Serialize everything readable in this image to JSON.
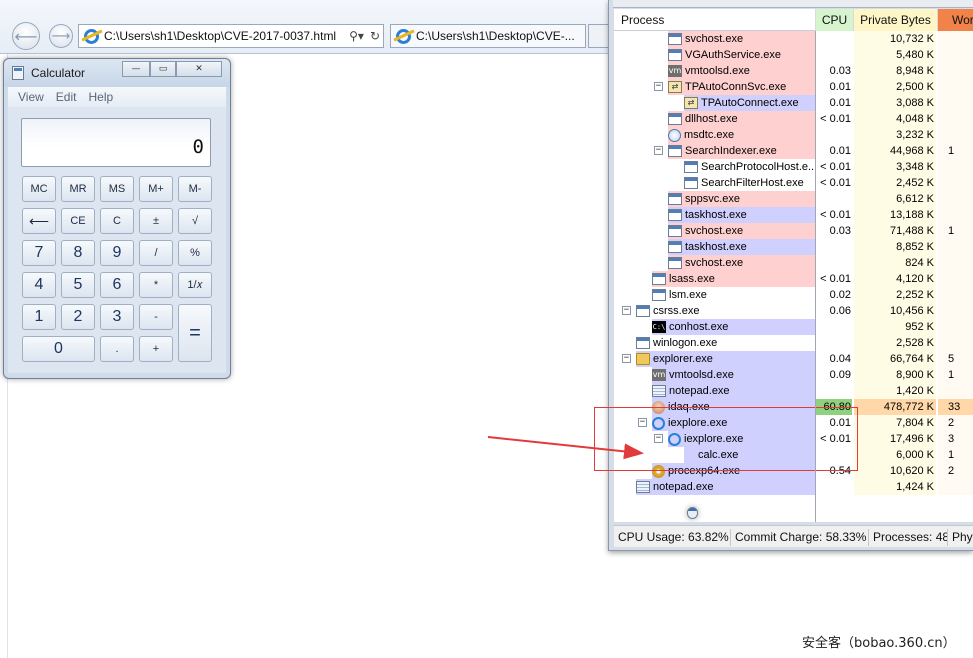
{
  "browser": {
    "address": "C:\\Users\\sh1\\Desktop\\CVE-2017-0037.html",
    "tab_title": "C:\\Users\\sh1\\Desktop\\CVE-...",
    "search_icon": "search-icon",
    "refresh_icon": "refresh-icon"
  },
  "calculator": {
    "title": "Calculator",
    "menu": [
      "View",
      "Edit",
      "Help"
    ],
    "display": "0",
    "keys": {
      "mc": "MC",
      "mr": "MR",
      "ms": "MS",
      "mplus": "M+",
      "mminus": "M-",
      "back": "⟵",
      "ce": "CE",
      "c": "C",
      "pm": "±",
      "sqrt": "√",
      "k7": "7",
      "k8": "8",
      "k9": "9",
      "div": "/",
      "pct": "%",
      "k4": "4",
      "k5": "5",
      "k6": "6",
      "mul": "*",
      "recip": "1/𝑥",
      "k1": "1",
      "k2": "2",
      "k3": "3",
      "sub": "-",
      "eq": "=",
      "k0": "0",
      "dot": ".",
      "add": "+"
    }
  },
  "procexp": {
    "headers": {
      "process": "Process",
      "cpu": "CPU",
      "private_bytes": "Private Bytes",
      "working_set": "Wor"
    },
    "colors": {
      "service": "#ffd0d0",
      "own": "#d0d0ff",
      "cpu_header": "#d6f5cf",
      "pb_header": "#fff6c8",
      "ws_header": "#f0824a",
      "highlight_cpu": "#8fd17e",
      "highlight_pb": "#ffd7a8"
    },
    "rows": [
      {
        "name": "svchost.exe",
        "cpu": "",
        "pb": "10,732 K",
        "ws": ""
      },
      {
        "name": "VGAuthService.exe",
        "cpu": "",
        "pb": "5,480 K",
        "ws": ""
      },
      {
        "name": "vmtoolsd.exe",
        "cpu": "0.03",
        "pb": "8,948 K",
        "ws": ""
      },
      {
        "name": "TPAutoConnSvc.exe",
        "cpu": "0.01",
        "pb": "2,500 K",
        "ws": ""
      },
      {
        "name": "TPAutoConnect.exe",
        "cpu": "0.01",
        "pb": "3,088 K",
        "ws": ""
      },
      {
        "name": "dllhost.exe",
        "cpu": "< 0.01",
        "pb": "4,048 K",
        "ws": ""
      },
      {
        "name": "msdtc.exe",
        "cpu": "",
        "pb": "3,232 K",
        "ws": ""
      },
      {
        "name": "SearchIndexer.exe",
        "cpu": "0.01",
        "pb": "44,968 K",
        "ws": "1"
      },
      {
        "name": "SearchProtocolHost.e...",
        "cpu": "< 0.01",
        "pb": "3,348 K",
        "ws": ""
      },
      {
        "name": "SearchFilterHost.exe",
        "cpu": "< 0.01",
        "pb": "2,452 K",
        "ws": ""
      },
      {
        "name": "sppsvc.exe",
        "cpu": "",
        "pb": "6,612 K",
        "ws": ""
      },
      {
        "name": "taskhost.exe",
        "cpu": "< 0.01",
        "pb": "13,188 K",
        "ws": ""
      },
      {
        "name": "svchost.exe",
        "cpu": "0.03",
        "pb": "71,488 K",
        "ws": "1"
      },
      {
        "name": "taskhost.exe",
        "cpu": "",
        "pb": "8,852 K",
        "ws": ""
      },
      {
        "name": "svchost.exe",
        "cpu": "",
        "pb": "824 K",
        "ws": ""
      },
      {
        "name": "lsass.exe",
        "cpu": "< 0.01",
        "pb": "4,120 K",
        "ws": ""
      },
      {
        "name": "lsm.exe",
        "cpu": "0.02",
        "pb": "2,252 K",
        "ws": ""
      },
      {
        "name": "csrss.exe",
        "cpu": "0.06",
        "pb": "10,456 K",
        "ws": ""
      },
      {
        "name": "conhost.exe",
        "cpu": "",
        "pb": "952 K",
        "ws": ""
      },
      {
        "name": "winlogon.exe",
        "cpu": "",
        "pb": "2,528 K",
        "ws": ""
      },
      {
        "name": "explorer.exe",
        "cpu": "0.04",
        "pb": "66,764 K",
        "ws": "5"
      },
      {
        "name": "vmtoolsd.exe",
        "cpu": "0.09",
        "pb": "8,900 K",
        "ws": "1"
      },
      {
        "name": "notepad.exe",
        "cpu": "",
        "pb": "1,420 K",
        "ws": ""
      },
      {
        "name": "idaq.exe",
        "cpu": "60.80",
        "pb": "478,772 K",
        "ws": "33"
      },
      {
        "name": "iexplore.exe",
        "cpu": "0.01",
        "pb": "7,804 K",
        "ws": "2"
      },
      {
        "name": "iexplore.exe",
        "cpu": "< 0.01",
        "pb": "17,496 K",
        "ws": "3"
      },
      {
        "name": "calc.exe",
        "cpu": "",
        "pb": "6,000 K",
        "ws": "1"
      },
      {
        "name": "procexp64.exe",
        "cpu": "0.54",
        "pb": "10,620 K",
        "ws": "2"
      },
      {
        "name": "notepad.exe",
        "cpu": "",
        "pb": "1,424 K",
        "ws": ""
      }
    ],
    "status": {
      "cpu": "CPU Usage: 63.82%",
      "commit": "Commit Charge: 58.33%",
      "processes": "Processes: 48",
      "phys": "Phys"
    }
  },
  "watermark": "安全客（bobao.360.cn）"
}
